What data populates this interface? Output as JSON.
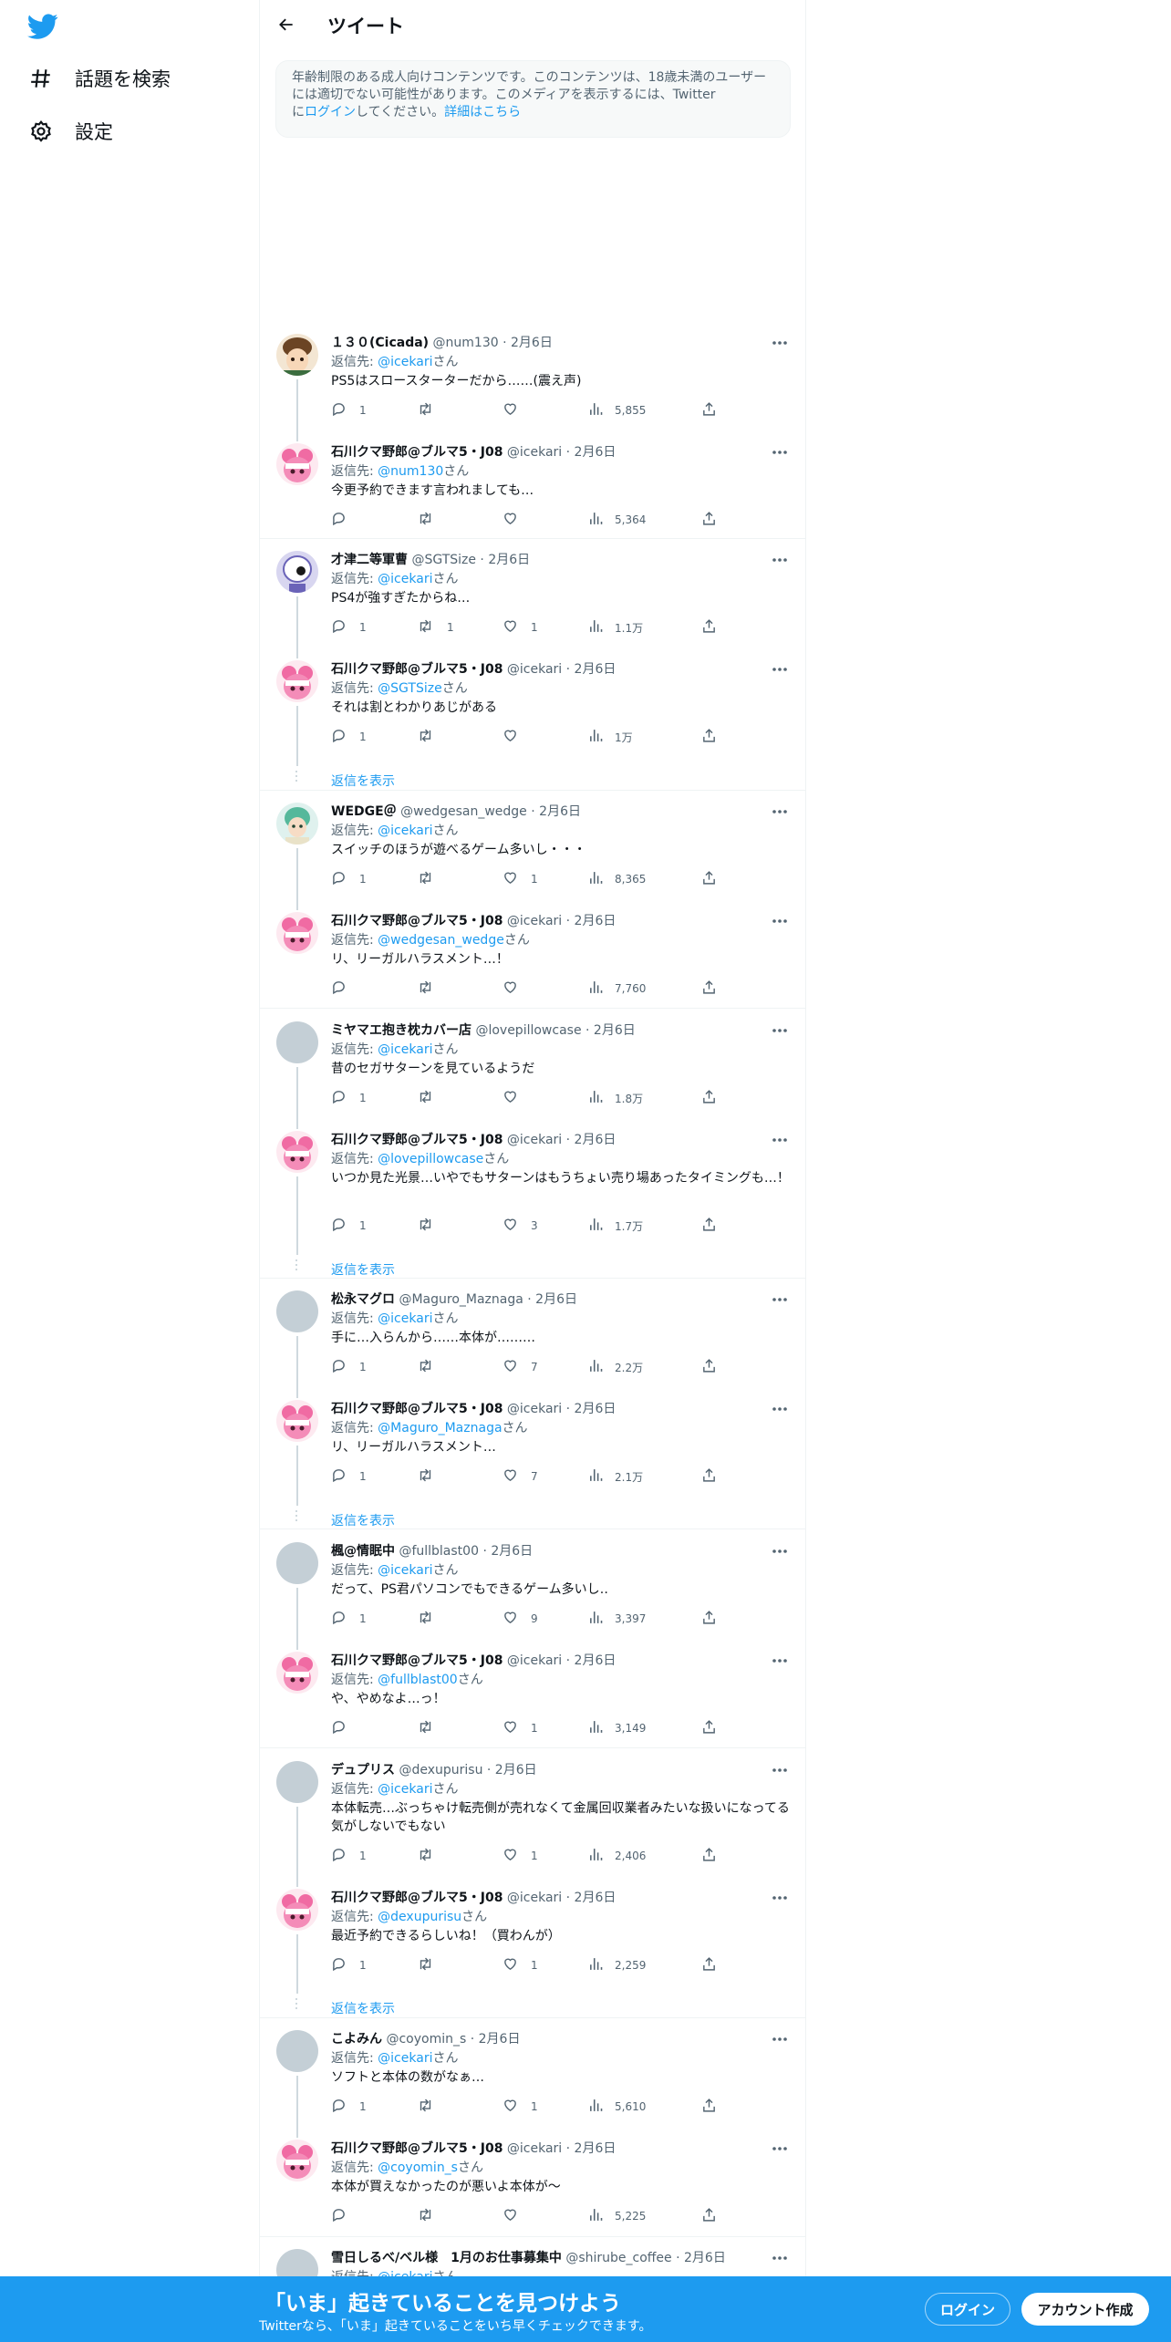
{
  "sidebar": {
    "items": [
      {
        "label": "話題を検索",
        "icon": "hashtag-icon"
      },
      {
        "label": "設定",
        "icon": "gear-icon"
      }
    ]
  },
  "header": {
    "title": "ツイート"
  },
  "notice": {
    "text1": "年齢制限のある成人向けコンテンツです。このコンテンツは、18歳未満のユーザーには適切でない可能性があります。このメディアを表示するには、Twitter",
    "text2": "に",
    "login_link": "ログイン",
    "text3": "してください。",
    "more_link": "詳細はこちら"
  },
  "reply_prefix": "返信先: ",
  "reply_suffix": "さん",
  "show_replies_label": "返信を表示",
  "tweets": [
    {
      "name": "１３０(Cicada)",
      "handle": "@num130",
      "date": "2月6日",
      "reply_to": "@icekari",
      "text": "PS5はスロースターターだから……(震え声)",
      "replies": "1",
      "retweets": "",
      "likes": "",
      "views": "5,855"
    },
    {
      "name": "石川クマ野郎@ブルマ5・J08",
      "handle": "@icekari",
      "date": "2月6日",
      "reply_to": "@num130",
      "text": "今更予約できます言われましても…",
      "replies": "",
      "retweets": "",
      "likes": "",
      "views": "5,364"
    },
    {
      "name": "才津二等軍曹",
      "handle": "@SGTSize",
      "date": "2月6日",
      "reply_to": "@icekari",
      "text": "PS4が強すぎたからね…",
      "replies": "1",
      "retweets": "1",
      "likes": "1",
      "views": "1.1万"
    },
    {
      "name": "石川クマ野郎@ブルマ5・J08",
      "handle": "@icekari",
      "date": "2月6日",
      "reply_to": "@SGTSize",
      "text": "それは割とわかりあじがある",
      "replies": "1",
      "retweets": "",
      "likes": "",
      "views": "1万"
    },
    {
      "name": "WEDGE＠",
      "handle": "@wedgesan_wedge",
      "date": "2月6日",
      "reply_to": "@icekari",
      "text": "スイッチのほうが遊べるゲーム多いし・・・",
      "replies": "1",
      "retweets": "",
      "likes": "1",
      "views": "8,365"
    },
    {
      "name": "石川クマ野郎@ブルマ5・J08",
      "handle": "@icekari",
      "date": "2月6日",
      "reply_to": "@wedgesan_wedge",
      "text": "リ、リーガルハラスメント…！",
      "replies": "",
      "retweets": "",
      "likes": "",
      "views": "7,760"
    },
    {
      "name": "ミヤマエ抱き枕カバー店",
      "handle": "@lovepillowcase",
      "date": "2月6日",
      "reply_to": "@icekari",
      "text": "昔のセガサターンを見ているようだ",
      "replies": "1",
      "retweets": "",
      "likes": "",
      "views": "1.8万"
    },
    {
      "name": "石川クマ野郎@ブルマ5・J08",
      "handle": "@icekari",
      "date": "2月6日",
      "reply_to": "@lovepillowcase",
      "text": "いつか見た光景…いやでもサターンはもうちょい売り場あったタイミングも…！",
      "replies": "1",
      "retweets": "",
      "likes": "3",
      "views": "1.7万"
    },
    {
      "name": "松永マグロ",
      "handle": "@Maguro_Maznaga",
      "date": "2月6日",
      "reply_to": "@icekari",
      "text": "手に…入らんから……本体が………",
      "replies": "1",
      "retweets": "",
      "likes": "7",
      "views": "2.2万"
    },
    {
      "name": "石川クマ野郎@ブルマ5・J08",
      "handle": "@icekari",
      "date": "2月6日",
      "reply_to": "@Maguro_Maznaga",
      "text": "リ、リーガルハラスメント…",
      "replies": "1",
      "retweets": "",
      "likes": "7",
      "views": "2.1万"
    },
    {
      "name": "楓@情眠中",
      "handle": "@fullblast00",
      "date": "2月6日",
      "reply_to": "@icekari",
      "text": "だって、PS君パソコンでもできるゲーム多いし‥",
      "replies": "1",
      "retweets": "",
      "likes": "9",
      "views": "3,397"
    },
    {
      "name": "石川クマ野郎@ブルマ5・J08",
      "handle": "@icekari",
      "date": "2月6日",
      "reply_to": "@fullblast00",
      "text": "や、やめなよ…っ！",
      "replies": "",
      "retweets": "",
      "likes": "1",
      "views": "3,149"
    },
    {
      "name": "デュプリス",
      "handle": "@dexupurisu",
      "date": "2月6日",
      "reply_to": "@icekari",
      "text": "本体転売…ぶっちゃけ転売側が売れなくて金属回収業者みたいな扱いになってる気がしないでもない",
      "replies": "1",
      "retweets": "",
      "likes": "1",
      "views": "2,406"
    },
    {
      "name": "石川クマ野郎@ブルマ5・J08",
      "handle": "@icekari",
      "date": "2月6日",
      "reply_to": "@dexupurisu",
      "text": "最近予約できるらしいね！（買わんが）",
      "replies": "1",
      "retweets": "",
      "likes": "1",
      "views": "2,259"
    },
    {
      "name": "こよみん",
      "handle": "@coyomin_s",
      "date": "2月6日",
      "reply_to": "@icekari",
      "text": "ソフトと本体の数がなぁ…",
      "replies": "1",
      "retweets": "",
      "likes": "1",
      "views": "5,610"
    },
    {
      "name": "石川クマ野郎@ブルマ5・J08",
      "handle": "@icekari",
      "date": "2月6日",
      "reply_to": "@coyomin_s",
      "text": "本体が買えなかったのが悪いよ本体が〜",
      "replies": "",
      "retweets": "",
      "likes": "",
      "views": "5,225"
    },
    {
      "name": "雪日しるべ/ベル様　1月のお仕事募集中",
      "handle": "@shirube_coffee",
      "date": "2月6日",
      "reply_to": "@icekari",
      "text": "",
      "replies": "",
      "retweets": "",
      "likes": "",
      "views": ""
    }
  ],
  "bottom_bar": {
    "title": "「いま」起きていることを見つけよう",
    "subtitle": "Twitterなら、「いま」起きていることをいち早くチェックできます。",
    "login": "ログイン",
    "signup": "アカウント作成"
  },
  "colors": {
    "accent": "#1d9bf0",
    "muted": "#536471",
    "text": "#0f1419"
  }
}
